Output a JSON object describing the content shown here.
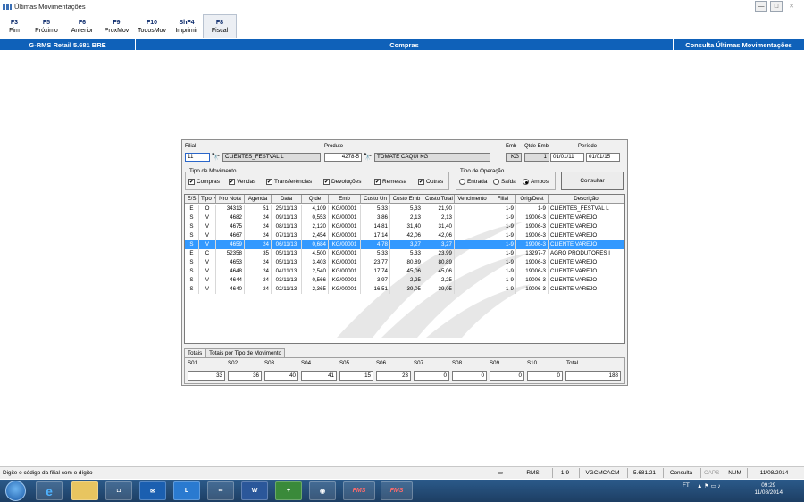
{
  "window": {
    "title": "Últimas Movimentações",
    "minimize": "—",
    "maximize": "□",
    "close": "✕"
  },
  "fkeys": [
    {
      "key": "F3",
      "label": "Fim"
    },
    {
      "key": "F5",
      "label": "Próximo"
    },
    {
      "key": "F6",
      "label": "Anterior"
    },
    {
      "key": "F9",
      "label": "ProxMov"
    },
    {
      "key": "F10",
      "label": "TodosMov"
    },
    {
      "key": "ShF4",
      "label": "Imprimir"
    },
    {
      "key": "F8",
      "label": "Fiscal"
    }
  ],
  "header": {
    "left": "G-RMS Retail 5.681 BRE",
    "center": "Compras",
    "right": "Consulta Últimas Movimentações"
  },
  "form": {
    "filial_label": "Filial",
    "filial_value": "11",
    "filial_name": "CLIENTES_FESTVAL L",
    "produto_label": "Produto",
    "produto_code": "4278-5",
    "produto_name": "TOMATE CAQUI KG",
    "emb_label": "Emb",
    "emb_value": "KG",
    "qtde_emb_label": "Qtde Emb",
    "qtde_emb_value": "1",
    "periodo_label": "Período",
    "periodo_start": "01/01/11",
    "periodo_end": "01/01/15"
  },
  "tipo_movimento": {
    "title": "Tipo de Movimento",
    "options": [
      "Compras",
      "Vendas",
      "Transferências",
      "Devoluções",
      "Remessa",
      "Outras"
    ]
  },
  "tipo_operacao": {
    "title": "Tipo de Operação",
    "options": [
      "Entrada",
      "Saída",
      "Ambos"
    ],
    "selected": "Ambos"
  },
  "consultar_label": "Consultar",
  "grid": {
    "columns": [
      "E/S",
      "Tipo NF",
      "Nro Nota",
      "Agenda",
      "Data",
      "Qtde",
      "Emb",
      "Custo Un",
      "Custo Emb",
      "Custo Total",
      "Vencimento",
      "Filial",
      "Orig/Dest",
      "Descrição"
    ],
    "rows": [
      [
        "E",
        "O",
        "34313",
        "51",
        "25/11/13",
        "4,109",
        "KG/00001",
        "5,33",
        "5,33",
        "21,90",
        "",
        "1-9",
        "1-9",
        "CLIENTES_FESTVAL L"
      ],
      [
        "S",
        "V",
        "4682",
        "24",
        "09/11/13",
        "0,553",
        "KG/00001",
        "3,86",
        "2,13",
        "2,13",
        "",
        "1-9",
        "19006-3",
        "CLIENTE VAREJO"
      ],
      [
        "S",
        "V",
        "4675",
        "24",
        "08/11/13",
        "2,120",
        "KG/00001",
        "14,81",
        "31,40",
        "31,40",
        "",
        "1-9",
        "19006-3",
        "CLIENTE VAREJO"
      ],
      [
        "S",
        "V",
        "4667",
        "24",
        "07/11/13",
        "2,454",
        "KG/00001",
        "17,14",
        "42,06",
        "42,06",
        "",
        "1-9",
        "19006-3",
        "CLIENTE VAREJO"
      ],
      [
        "S",
        "V",
        "4659",
        "24",
        "06/11/13",
        "0,684",
        "KG/00001",
        "4,78",
        "3,27",
        "3,27",
        "",
        "1-9",
        "19006-3",
        "CLIENTE VAREJO"
      ],
      [
        "E",
        "C",
        "52358",
        "35",
        "05/11/13",
        "4,500",
        "KG/00001",
        "5,33",
        "5,33",
        "23,99",
        "",
        "1-9",
        "13297-7",
        "AGRO PRODUTORES I"
      ],
      [
        "S",
        "V",
        "4653",
        "24",
        "05/11/13",
        "3,403",
        "KG/00001",
        "23,77",
        "80,89",
        "80,89",
        "",
        "1-9",
        "19006-3",
        "CLIENTE VAREJO"
      ],
      [
        "S",
        "V",
        "4648",
        "24",
        "04/11/13",
        "2,540",
        "KG/00001",
        "17,74",
        "45,06",
        "45,06",
        "",
        "1-9",
        "19006-3",
        "CLIENTE VAREJO"
      ],
      [
        "S",
        "V",
        "4644",
        "24",
        "03/11/13",
        "0,566",
        "KG/00001",
        "3,97",
        "2,25",
        "2,25",
        "",
        "1-9",
        "19006-3",
        "CLIENTE VAREJO"
      ],
      [
        "S",
        "V",
        "4640",
        "24",
        "02/11/13",
        "2,365",
        "KG/00001",
        "16,51",
        "39,05",
        "39,05",
        "",
        "1-9",
        "19006-3",
        "CLIENTE VAREJO"
      ]
    ],
    "selected_row": 4
  },
  "tabs": [
    "Totais",
    "Totais por Tipo de Movimento"
  ],
  "totals": {
    "labels": [
      "S01",
      "S02",
      "S03",
      "S04",
      "S05",
      "S06",
      "S07",
      "S08",
      "S09",
      "S10",
      "Total"
    ],
    "values": [
      "33",
      "36",
      "40",
      "41",
      "15",
      "23",
      "0",
      "0",
      "0",
      "0",
      "188"
    ]
  },
  "statusbar": {
    "message": "Digite o código da filial com o dígito",
    "cells": [
      "RMS",
      "1-9",
      "VGCMCACM",
      "5.681.21",
      "Consulta",
      "CAPS",
      "NUM",
      "11/08/2014"
    ]
  },
  "taskbar": {
    "apps": [
      "e",
      "FMS",
      "FMS"
    ],
    "tray_text": "FT",
    "time": "09:29",
    "date": "11/08/2014"
  }
}
